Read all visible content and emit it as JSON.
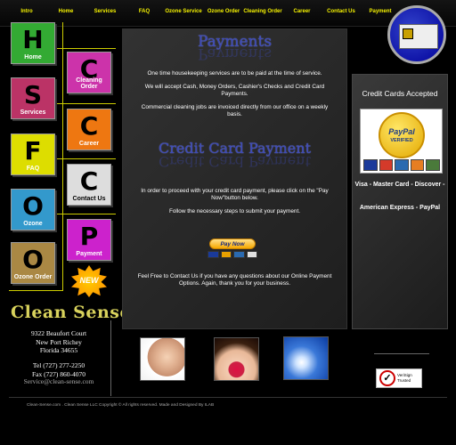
{
  "nav": [
    {
      "label": "Intro"
    },
    {
      "label": "Home"
    },
    {
      "label": "Services"
    },
    {
      "label": "FAQ"
    },
    {
      "label": "Ozone Service"
    },
    {
      "label": "Ozone Order"
    },
    {
      "label": "Cleaning Order"
    },
    {
      "label": "Career"
    },
    {
      "label": "Contact Us"
    },
    {
      "label": "Payment"
    }
  ],
  "tiles": [
    {
      "letter": "H",
      "label": "Home",
      "color": "#33aa33"
    },
    {
      "letter": "S",
      "label": "Services",
      "color": "#bb3366"
    },
    {
      "letter": "F",
      "label": "FAQ",
      "color": "#dddd00"
    },
    {
      "letter": "O",
      "label": "Ozone",
      "color": "#3399cc"
    },
    {
      "letter": "O",
      "label": "Ozone Order",
      "color": "#aa8844"
    },
    {
      "letter": "C",
      "label": "Cleaning Order",
      "color": "#cc33aa"
    },
    {
      "letter": "C",
      "label": "Career",
      "color": "#ee7711"
    },
    {
      "letter": "C",
      "label": "Contact Us",
      "color": "#dddddd"
    },
    {
      "letter": "P",
      "label": "Payment",
      "color": "#cc22cc"
    }
  ],
  "new_badge": "NEW",
  "brand": "Clean Sense",
  "address": {
    "line1": "9322 Beaufort Court",
    "line2": "New Port Richey",
    "line3": "Florida 34655"
  },
  "phones": {
    "tel": "Tel (727) 277-2250",
    "fax": "Fax (727) 860-4070"
  },
  "email": "Service@clean-sense.com",
  "payments": {
    "title": "Payments",
    "p1": "One time housekeeping services are to be paid at the time of service.",
    "p2": "We will accept Cash, Money Orders, Cashier's Checks and Credit Card Payments.",
    "p3": "Commercial cleaning jobs are invoiced directly from our office on a weekly basis."
  },
  "credit": {
    "title": "Credit Card Payment",
    "p1": "In order to proceed with your credit card payment, please click on the \"Pay Now\"button below.",
    "p2": "Follow the necessary steps to submit your payment.",
    "paynow_label": "Pay Now",
    "p3": "Feel Free to Contact Us if you have any questions about our Online Payment Options. Again, thank you for your business."
  },
  "sidebar": {
    "title": "Credit Cards Accepted",
    "seal_top": "PayPal",
    "seal_bottom": "VERIFIED",
    "line1": "Visa - Master Card - Discover -",
    "line2": "American Express - PayPal"
  },
  "verisign": {
    "label": "VeriSign Trusted"
  },
  "footer": "Clean-Sense.com . Clean Sense LLC Copyright © All rights reserved. Made and Designed By ILAB",
  "colors": {
    "nav_text": "#f4f100",
    "title_blue": "#3d4ab4",
    "brand": "#d8d25c"
  }
}
